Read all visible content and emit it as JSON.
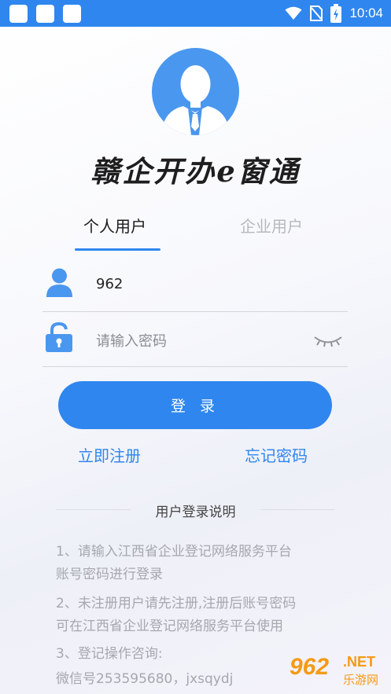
{
  "status_bar": {
    "time": "10:04"
  },
  "app": {
    "brand_title": "赣企开办e窗通"
  },
  "tabs": [
    {
      "label": "个人用户",
      "active": true
    },
    {
      "label": "企业用户",
      "active": false
    }
  ],
  "form": {
    "username_value": "962",
    "password_placeholder": "请输入密码",
    "login_label": "登 录",
    "register_label": "立即注册",
    "forgot_label": "忘记密码"
  },
  "instructions": {
    "title": "用户登录说明",
    "lines": [
      "1、请输入江西省企业登记网络服务平台",
      "账号密码进行登录",
      "2、未注册用户请先注册,注册后账号密码",
      "可在江西省企业登记网络服务平台使用",
      "3、登记操作咨询:",
      "微信号253595680，jxsqydj"
    ]
  },
  "watermark": {
    "number": "962",
    "net": ".NET",
    "sub": "乐游网"
  },
  "colors": {
    "accent": "#2f86ef",
    "muted": "#a6a8ae",
    "watermark": "#f59a14"
  },
  "icons": [
    "wifi-icon",
    "no-sim-icon",
    "battery-icon",
    "user-icon",
    "lock-icon",
    "eye-closed-icon"
  ]
}
